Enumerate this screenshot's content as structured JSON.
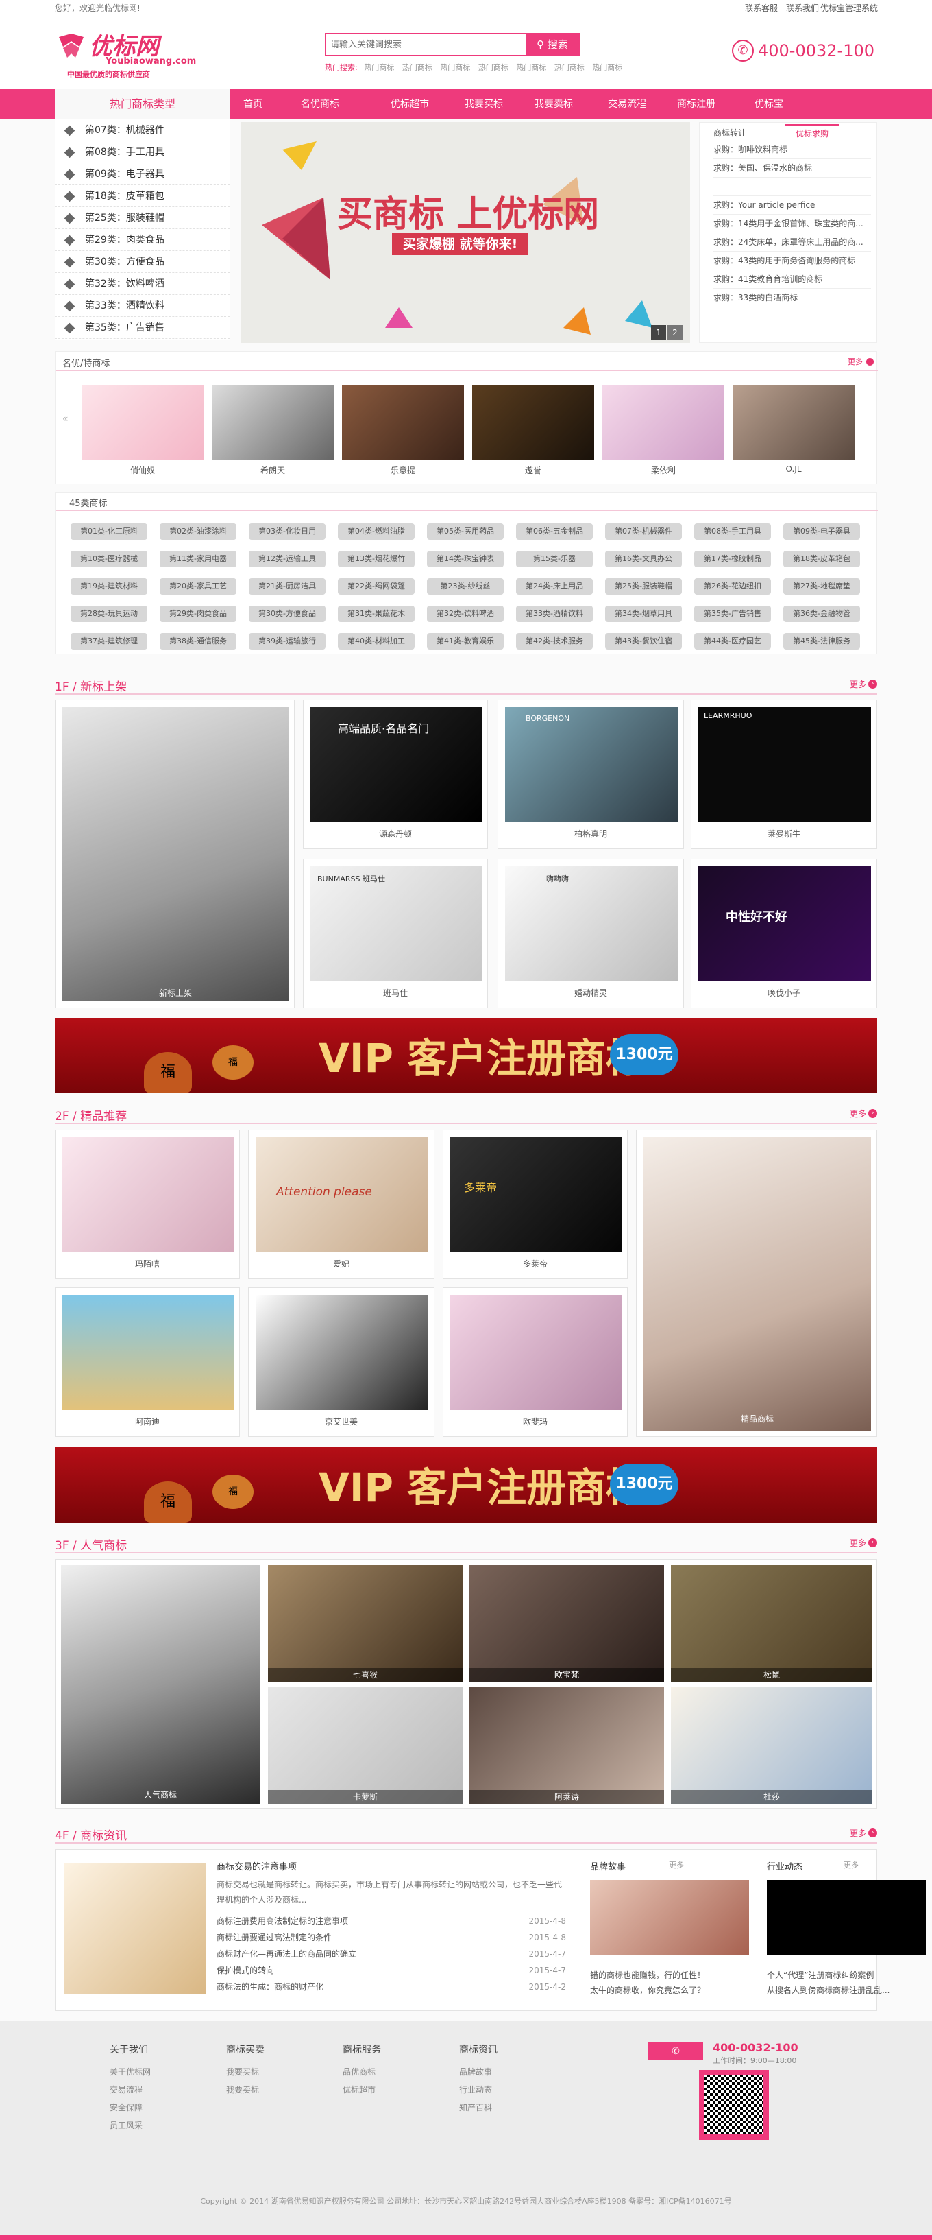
{
  "topbar": {
    "greeting": "您好，欢迎光临优标网!",
    "links": [
      "联系客服",
      "联系我们",
      "优标宝管理系统"
    ]
  },
  "logo": {
    "name": "优标网",
    "domain": "Youbiaowang.com",
    "slogan": "中国最优质的商标供应商"
  },
  "search": {
    "placeholder": "请输入关键词搜索",
    "button": "搜索",
    "hot_label": "热门搜索:",
    "hot_words": [
      "热门商标",
      "热门商标",
      "热门商标",
      "热门商标",
      "热门商标",
      "热门商标",
      "热门商标"
    ]
  },
  "hotline": "400-0032-100",
  "nav": [
    "首页",
    "名优商标",
    "优标超市",
    "我要买标",
    "我要卖标",
    "交易流程",
    "商标注册",
    "优标宝"
  ],
  "sidebar": {
    "title": "热门商标类型",
    "items": [
      "第07类：机械器件",
      "第08类：手工用具",
      "第09类：电子器具",
      "第18类：皮革箱包",
      "第25类：服装鞋帽",
      "第29类：肉类食品",
      "第30类：方便食品",
      "第32类：饮料啤酒",
      "第33类：酒精饮料",
      "第35类：广告销售"
    ]
  },
  "banner": {
    "headline": "买商标 上优标网",
    "sub": "买家爆棚 就等你来!",
    "pages": [
      "1",
      "2"
    ]
  },
  "news_tabs": [
    "商标转让",
    "优标求购"
  ],
  "news_list": [
    "求购：咖啡饮料商标",
    "求购：美国、保温水的商标",
    "",
    "求购：Your article perfice",
    "求购：14类用于金银首饰、珠宝类的商...",
    "求购：24类床单，床罩等床上用品的商...",
    "求购：43类的用于商务咨询服务的商标",
    "求购：41类教育育培训的商标",
    "求购：33类的白酒商标"
  ],
  "famous": {
    "title": "名优/特商标",
    "more": "更多",
    "items": [
      "俏仙奴",
      "希朗天",
      "乐意提",
      "遨誉",
      "柔依利",
      "O.JL"
    ]
  },
  "classes45": {
    "title": "45类商标",
    "items": [
      "第01类-化工原料",
      "第02类-油漆涂料",
      "第03类-化妆日用",
      "第04类-燃料油脂",
      "第05类-医用药品",
      "第06类-五金制品",
      "第07类-机械器件",
      "第08类-手工用具",
      "第09类-电子器具",
      "第10类-医疗器械",
      "第11类-家用电器",
      "第12类-运输工具",
      "第13类-烟花爆竹",
      "第14类-珠宝钟表",
      "第15类-乐器",
      "第16类-文具办公",
      "第17类-橡胶制品",
      "第18类-皮革箱包",
      "第19类-建筑材料",
      "第20类-家具工艺",
      "第21类-厨房洁具",
      "第22类-绳网袋篷",
      "第23类-纱线丝",
      "第24类-床上用品",
      "第25类-服装鞋帽",
      "第26类-花边纽扣",
      "第27类-地毯席垫",
      "第28类-玩具运动",
      "第29类-肉类食品",
      "第30类-方便食品",
      "第31类-果蔬花木",
      "第32类-饮料啤酒",
      "第33类-酒精饮料",
      "第34类-烟草用具",
      "第35类-广告销售",
      "第36类-金融物管",
      "第37类-建筑修理",
      "第38类-通信服务",
      "第39类-运输旅行",
      "第40类-材料加工",
      "第41类-教育娱乐",
      "第42类-技术服务",
      "第43类-餐饮住宿",
      "第44类-医疗园艺",
      "第45类-法律服务"
    ]
  },
  "floor1": {
    "title": "1F / 新标上架",
    "more": "更多",
    "big_cap": "新标上架",
    "items": [
      "源森丹顿",
      "柏格真明",
      "莱曼斯牛",
      "班马仕",
      "婚动精灵",
      "唤伐小子"
    ],
    "img_texts": [
      "高端品质·名品名门",
      "BORGENON",
      "LEARMRHUO",
      "BUNMARSS 班马仕",
      "嗨嗨嗨",
      "中性好不好"
    ]
  },
  "vip": {
    "text": "VIP 客户注册商标",
    "price": "1300元",
    "fu": "福"
  },
  "floor2": {
    "title": "2F / 精品推荐",
    "more": "更多",
    "big_cap": "精品商标",
    "items": [
      "玛陌嘻",
      "爱妃",
      "多莱帝",
      "阿南迪",
      "京艾世美",
      "欧斐玛"
    ],
    "img_texts": [
      "Attention please",
      "多莱帝"
    ]
  },
  "floor3": {
    "title": "3F / 人气商标",
    "more": "更多",
    "big_cap": "人气商标",
    "items": [
      "七喜猴",
      "欧宝梵",
      "松鼠",
      "卡萝斯",
      "阿莱诗",
      "杜莎"
    ]
  },
  "floor4": {
    "title": "4F / 商标资讯",
    "more": "更多",
    "main": {
      "title": "商标交易的注意事项",
      "desc": "商标交易也就是商标转让。商标买卖，市场上有专门从事商标转让的网站或公司，也不乏一些代理机构的个人涉及商标...",
      "list": [
        {
          "t": "商标注册费用高法制定标的注意事项",
          "d": "2015-4-8"
        },
        {
          "t": "商标注册要通过高法制定的条件",
          "d": "2015-4-8"
        },
        {
          "t": "商标财产化—再通法上的商品同的确立",
          "d": "2015-4-7"
        },
        {
          "t": "保护模式的转向",
          "d": "2015-4-7"
        },
        {
          "t": "商标法的生成：商标的财产化",
          "d": "2015-4-2"
        }
      ]
    },
    "story": {
      "title": "品牌故事",
      "more": "更多",
      "list": [
        "错的商标也能赚钱，行的任性！",
        "太牛的商标收，你究竟怎么了？"
      ]
    },
    "industry": {
      "title": "行业动态",
      "more": "更多",
      "list": [
        "个人“代理”注册商标纠纷案例",
        "从搜名人到傍商标商标注册乱乱..."
      ]
    }
  },
  "footer": {
    "cols": [
      {
        "h": "关于我们",
        "l": [
          "关于优标网",
          "交易流程",
          "安全保障",
          "员工风采"
        ]
      },
      {
        "h": "商标买卖",
        "l": [
          "我要买标",
          "我要卖标"
        ]
      },
      {
        "h": "商标服务",
        "l": [
          "品优商标",
          "优标超市"
        ]
      },
      {
        "h": "商标资讯",
        "l": [
          "品牌故事",
          "行业动态",
          "知产百科"
        ]
      }
    ],
    "phone": "400-0032-100",
    "hours": "工作时间：9:00—18:00",
    "copyright": "Copyright © 2014 湖南省优易知识产权服务有限公司 公司地址：长沙市天心区韶山南路242号益园大商业综合楼A座5楼1908 备案号：湘ICP备14016071号"
  },
  "colors": {
    "brand": "#ee3a7c",
    "accent": "#e8326d"
  }
}
